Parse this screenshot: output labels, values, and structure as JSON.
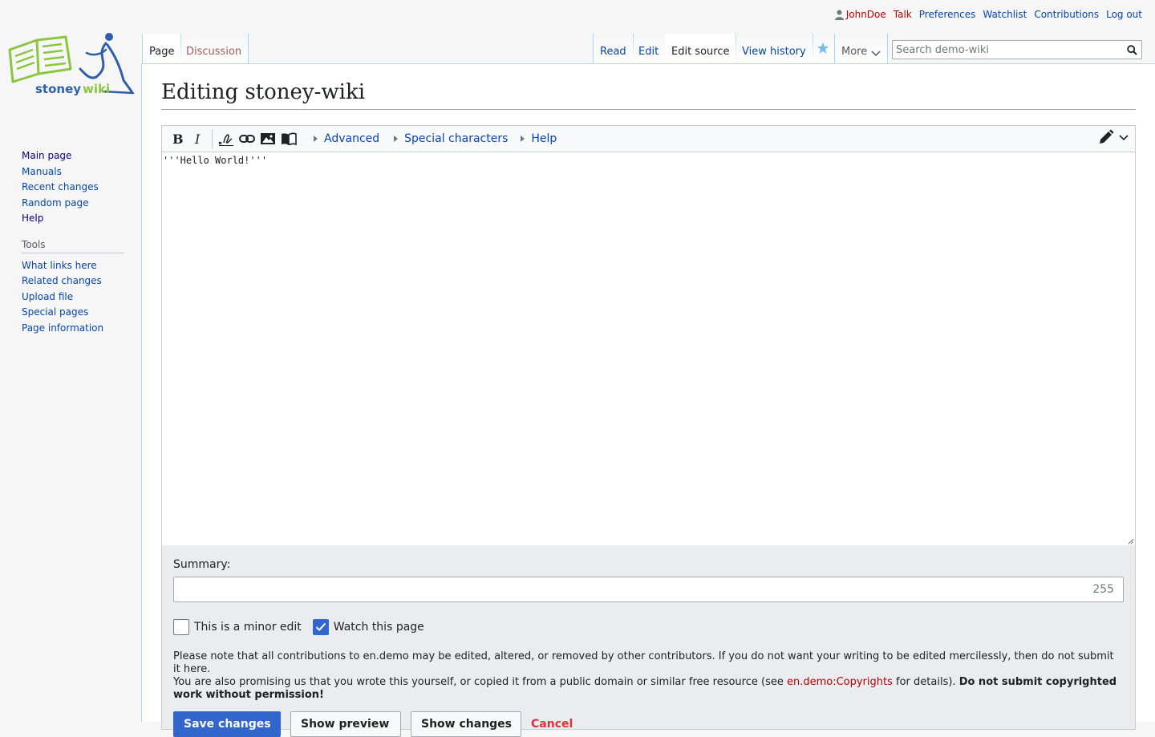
{
  "personal_tools": {
    "username": "JohnDoe",
    "talk": "Talk",
    "preferences": "Preferences",
    "watchlist": "Watchlist",
    "contributions": "Contributions",
    "logout": "Log out"
  },
  "logo": {
    "part1": "stoney",
    "part2": "wiki"
  },
  "tabs": {
    "page": "Page",
    "discussion": "Discussion",
    "read": "Read",
    "edit": "Edit",
    "edit_source": "Edit source",
    "view_history": "View history",
    "more": "More"
  },
  "search": {
    "placeholder": "Search demo-wiki"
  },
  "sidebar": {
    "navigation": [
      "Main page",
      "Manuals",
      "Recent changes",
      "Random page",
      "Help"
    ],
    "tools_heading": "Tools",
    "tools": [
      "What links here",
      "Related changes",
      "Upload file",
      "Special pages",
      "Page information"
    ]
  },
  "page": {
    "heading": "Editing stoney-wiki"
  },
  "editor": {
    "toolbar_links": {
      "advanced": "Advanced",
      "special_characters": "Special characters",
      "help": "Help"
    },
    "content": "'''Hello World!'''"
  },
  "options": {
    "summary_label": "Summary:",
    "summary_value": "",
    "summary_remaining": "255",
    "minor_edit_label": "This is a minor edit",
    "minor_edit_checked": false,
    "watch_label": "Watch this page",
    "watch_checked": true,
    "notice_line1": "Please note that all contributions to en.demo may be edited, altered, or removed by other contributors. If you do not want your writing to be edited mercilessly, then do not submit it here.",
    "notice_line2_pre": "You are also promising us that you wrote this yourself, or copied it from a public domain or similar free resource (see ",
    "notice_link": "en.demo:Copyrights",
    "notice_line2_post": " for details). ",
    "notice_bold": "Do not submit copyrighted work without permission!",
    "save_label": "Save changes",
    "preview_label": "Show preview",
    "changes_label": "Show changes",
    "cancel_label": "Cancel"
  },
  "colors": {
    "link": "#0645ad",
    "redlink": "#ba0000",
    "primary": "#3366cc",
    "logo_green": "#8cc63e",
    "logo_blue": "#2f5faa"
  }
}
